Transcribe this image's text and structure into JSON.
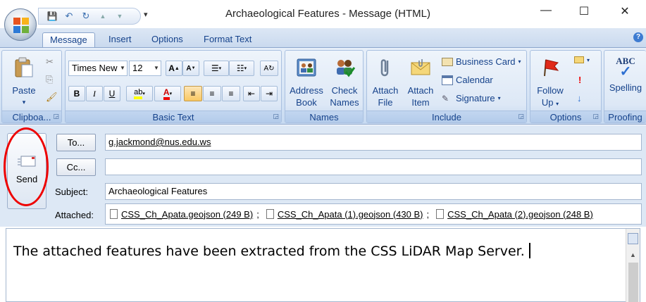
{
  "window": {
    "title": "Archaeological Features - Message (HTML)",
    "minimize": "—",
    "maximize": "☐",
    "close": "✕"
  },
  "qat": {
    "save": "💾",
    "undo": "↶",
    "redo": "↻",
    "prev": "▲",
    "next": "▼",
    "more": "▾"
  },
  "tabs": [
    "Message",
    "Insert",
    "Options",
    "Format Text"
  ],
  "help": "?",
  "ribbon": {
    "clipboard": {
      "label": "Clipboa...",
      "paste": "Paste"
    },
    "basic_text": {
      "label": "Basic Text",
      "font": "Times New",
      "size": "12",
      "grow": "A",
      "shrink": "A",
      "bold": "B",
      "italic": "I",
      "underline": "U"
    },
    "names": {
      "label": "Names",
      "address_book": [
        "Address",
        "Book"
      ],
      "check_names": [
        "Check",
        "Names"
      ]
    },
    "include": {
      "label": "Include",
      "attach_file": [
        "Attach",
        "File"
      ],
      "attach_item": [
        "Attach",
        "Item"
      ],
      "business_card": "Business Card",
      "calendar": "Calendar",
      "signature": "Signature"
    },
    "options": {
      "label": "Options",
      "follow_up": [
        "Follow",
        "Up"
      ]
    },
    "proofing": {
      "label": "Proofing",
      "spelling": "Spelling",
      "abc": "ABC"
    }
  },
  "compose": {
    "send": "Send",
    "to_btn": "To...",
    "cc_btn": "Cc...",
    "to_value": "g.jackmond@nus.edu.ws",
    "cc_value": "",
    "subject_label": "Subject:",
    "subject_value": "Archaeological Features",
    "attached_label": "Attached:",
    "attachments": [
      "CSS_Ch_Apata.geojson (249 B)",
      "CSS_Ch_Apata (1).geojson (430 B)",
      "CSS_Ch_Apata (2).geojson (248 B)"
    ],
    "separator": ";"
  },
  "body_text": "The attached features have been extracted from the CSS LiDAR Map Server."
}
